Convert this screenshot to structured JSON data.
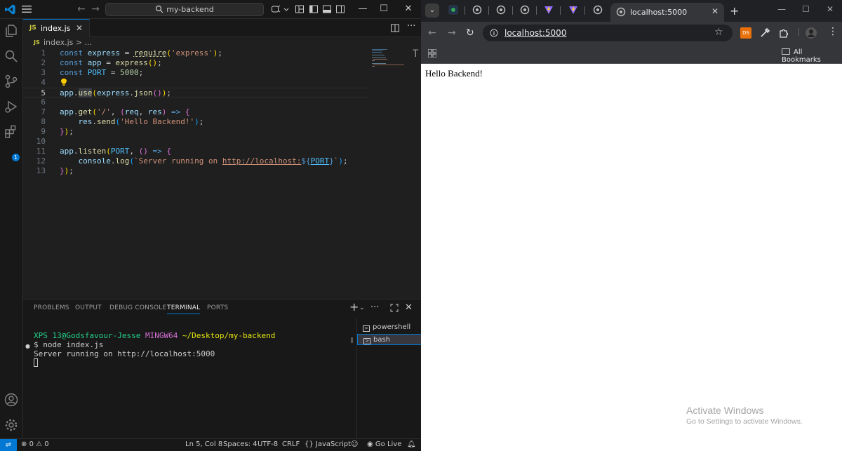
{
  "vscode": {
    "search_text": "my-backend",
    "tab": {
      "icon_text": "JS",
      "name": "index.js",
      "close": "✕"
    },
    "breadcrumb": {
      "icon_text": "JS",
      "text": "index.js > ..."
    },
    "extensions_badge": "1",
    "code_lines": [
      "1",
      "2",
      "3",
      "4",
      "5",
      "6",
      "7",
      "8",
      "9",
      "10",
      "11",
      "12",
      "13"
    ],
    "panel": {
      "tabs": [
        "PROBLEMS",
        "OUTPUT",
        "DEBUG CONSOLE",
        "TERMINAL",
        "PORTS"
      ],
      "active_tab": "TERMINAL",
      "terminal": {
        "user": "XPS 13@Godsfavour-Jesse",
        "env": "MINGW64",
        "path": "~/Desktop/my-backend",
        "command": "$ node index.js",
        "output": "Server running on http://localhost:5000"
      },
      "terminals": [
        "powershell",
        "bash"
      ],
      "selected_terminal": "bash"
    },
    "status": {
      "errors": "0",
      "warnings": "0",
      "position": "Ln 5, Col 8",
      "spaces": "Spaces: 4",
      "encoding": "UTF-8",
      "eol": "CRLF",
      "language": "JavaScript",
      "go_live": "Go Live"
    }
  },
  "browser": {
    "tab_title": "localhost:5000",
    "url": "localhost:5000",
    "extension_label": "DS",
    "all_bookmarks": "All Bookmarks",
    "page_text": "Hello Backend!",
    "watermark_title": "Activate Windows",
    "watermark_sub": "Go to Settings to activate Windows."
  },
  "colors": {
    "accent": "#0078d4",
    "keyword": "#569cd6",
    "function": "#dcdcaa",
    "variable": "#9cdcfe",
    "string": "#ce9178",
    "number": "#b5cea8"
  }
}
